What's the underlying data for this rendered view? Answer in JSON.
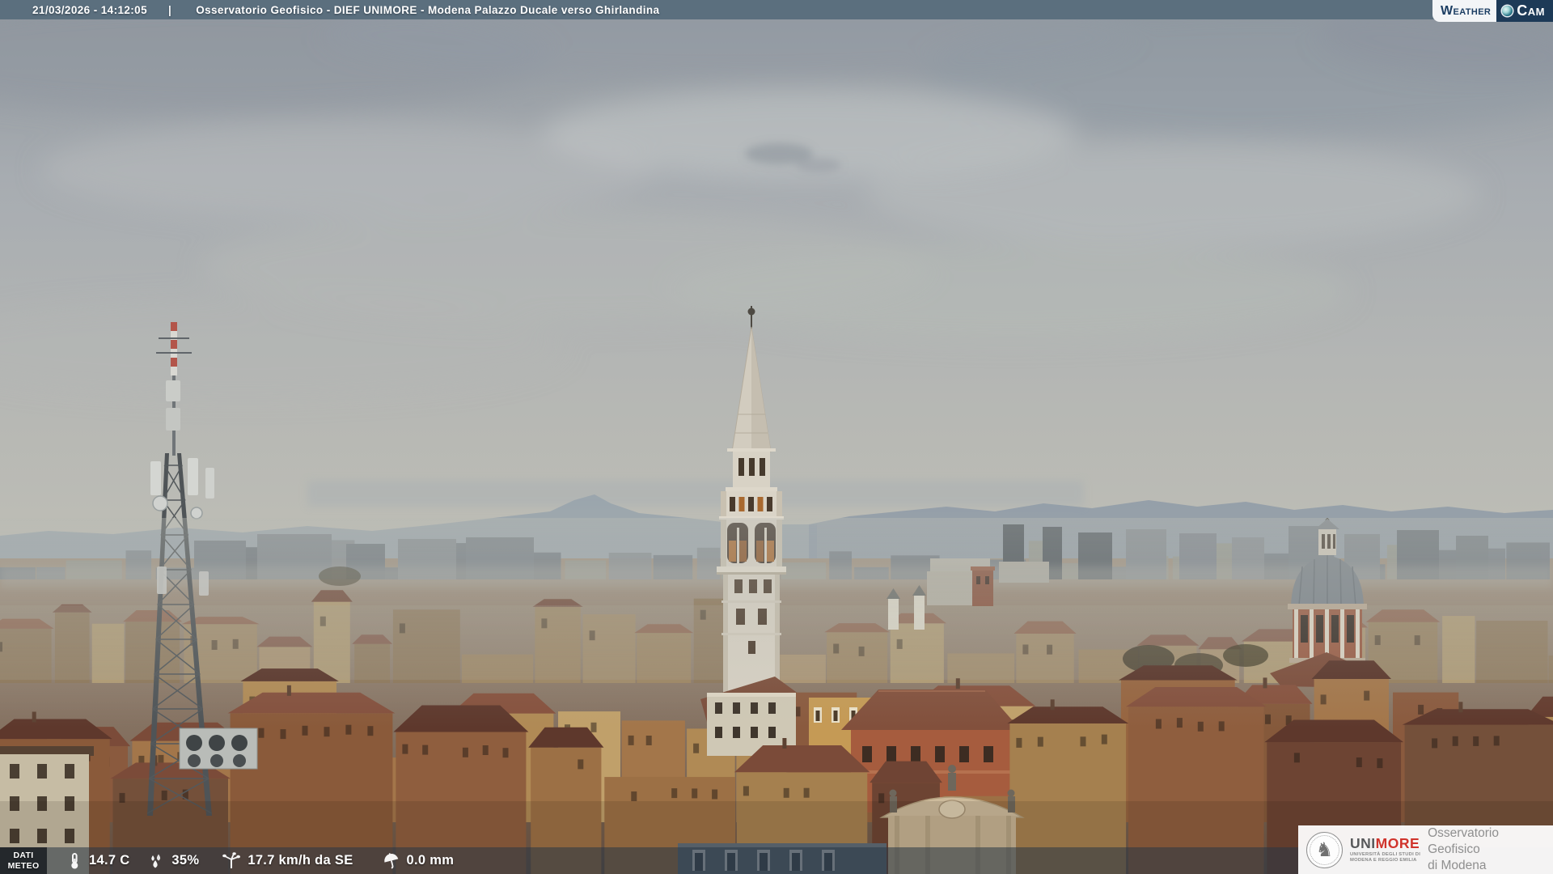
{
  "header": {
    "timestamp": "21/03/2026 - 14:12:05",
    "separator": "|",
    "title": "Osservatorio Geofisico - DIEF UNIMORE - Modena Palazzo Ducale verso Ghirlandina",
    "bar_color": "#5b6f7e"
  },
  "watermark": {
    "weather": "Weather",
    "cam": "Cam",
    "navy": "#1d3a57",
    "lens_icon": "camera-lens-icon"
  },
  "weather": {
    "source_label": {
      "line1": "DATI",
      "line2": "METEO"
    },
    "temperature": "14.7 C",
    "humidity": "35%",
    "wind": "17.7 km/h da SE",
    "precipitation": "0.0 mm",
    "icons": {
      "temperature": "thermometer-icon",
      "humidity": "water-drops-icon",
      "wind": "anemometer-icon",
      "precipitation": "umbrella-icon"
    }
  },
  "branding": {
    "acronym_prefix": "UNI",
    "acronym_suffix": "MORE",
    "university_line1": "UNIVERSITÀ DEGLI STUDI DI",
    "university_line2": "MODENA E REGGIO EMILIA",
    "observatory_line1": "Osservatorio Geofisico",
    "observatory_line2": "di Modena",
    "seal_icon": "unimore-seal-icon",
    "accent_red": "#d0342c",
    "text_gray": "#8f8f8f"
  },
  "scene": {
    "landmarks": [
      "ghirlandina-tower",
      "telecom-antenna-tower",
      "church-dome",
      "church-facade"
    ],
    "sky": "overcast"
  }
}
